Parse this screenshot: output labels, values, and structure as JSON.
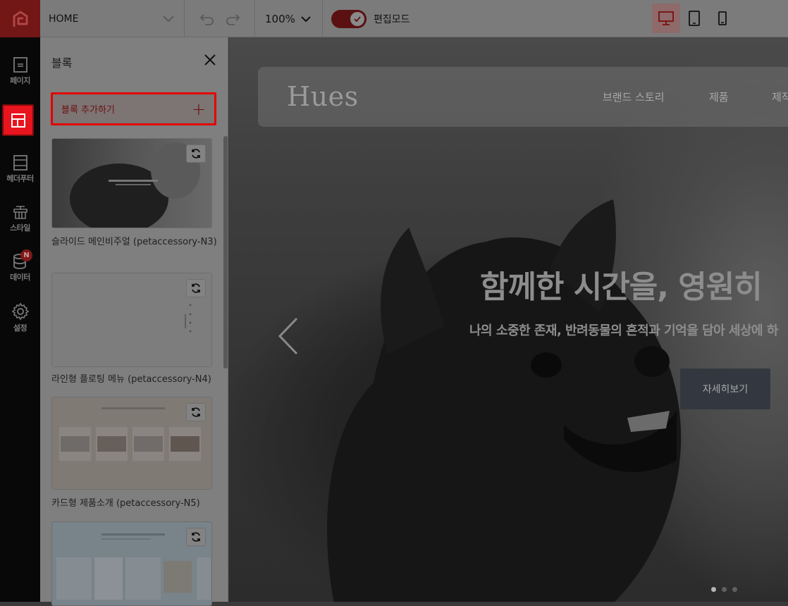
{
  "topbar": {
    "page_name": "HOME",
    "zoom": "100%",
    "edit_mode_label": "편집모드",
    "edit_mode_on": true,
    "devices": [
      "desktop",
      "tablet",
      "mobile"
    ],
    "active_device": "desktop"
  },
  "leftbar": {
    "items": [
      {
        "label": "페이지",
        "icon": "page-icon"
      },
      {
        "label": "",
        "icon": "block-layout-icon"
      },
      {
        "label": "헤더푸터",
        "icon": "header-footer-icon"
      },
      {
        "label": "스타일",
        "icon": "style-icon"
      },
      {
        "label": "데이터",
        "icon": "database-icon"
      },
      {
        "label": "설정",
        "icon": "gear-icon"
      }
    ],
    "data_badge": "N"
  },
  "panel": {
    "title": "블록",
    "add_block_label": "블록 추가하기",
    "cards": [
      {
        "label": "슬라이드 메인비주얼 (petaccessory-N3)"
      },
      {
        "label": "라인형 플로팅 메뉴 (petaccessory-N4)"
      },
      {
        "label": "카드형 제품소개 (petaccessory-N5)"
      },
      {
        "label": ""
      }
    ]
  },
  "canvas": {
    "brand": "Hues",
    "nav": [
      "브랜드 스토리",
      "제품",
      "제작"
    ],
    "hero_title": "함께한 시간을, 영원히",
    "hero_subtitle": "나의 소중한 존재, 반려동물의 흔적과 기억을 담아 세상에 하",
    "hero_button": "자세히보기",
    "slides": 3,
    "active_slide": 1
  },
  "colors": {
    "brand_red": "#e8141e",
    "overlay": "#7f7f7f"
  }
}
